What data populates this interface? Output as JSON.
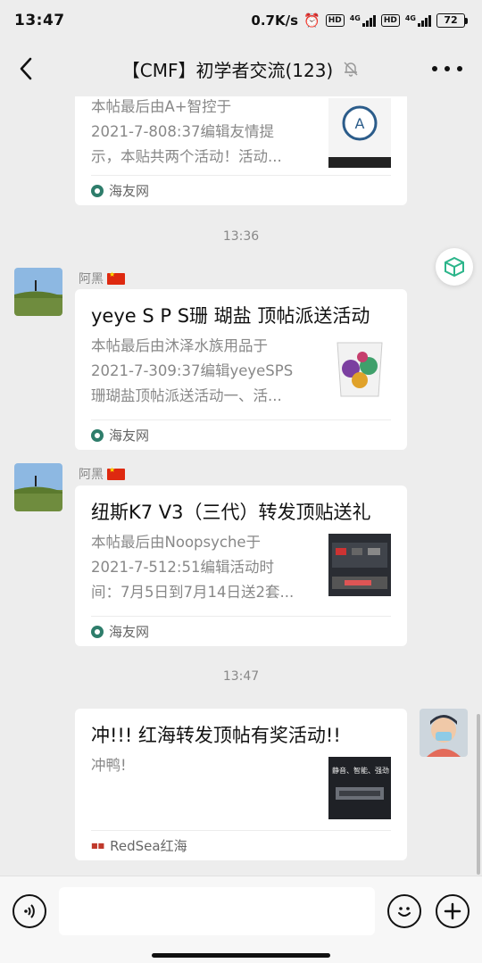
{
  "status": {
    "time": "13:47",
    "speed": "0.7K/s",
    "hd": "HD",
    "net": "4G",
    "battery": "72"
  },
  "header": {
    "title": "【CMF】初学者交流(123)"
  },
  "messages": [
    {
      "title_partial": "本帖最后由A+智控于",
      "desc_lines": [
        "2021-7-808:37编辑友情提",
        "示，本贴共两个活动！活动..."
      ],
      "source": "海友网"
    },
    {
      "timestamp": "13:36",
      "sender": "阿黑",
      "title": "yeye S P S珊 瑚盐 顶帖派送活动",
      "desc_lines": [
        "本帖最后由沐泽水族用品于",
        "2021-7-309:37编辑yeyeSPS",
        "珊瑚盐顶帖派送活动一、活..."
      ],
      "source": "海友网"
    },
    {
      "sender": "阿黑",
      "title": "纽斯K7 V3（三代）转发顶贴送礼",
      "desc_lines": [
        "本帖最后由Noopsyche于",
        "2021-7-512:51编辑活动时",
        "间：7月5日到7月14日送2套..."
      ],
      "source": "海友网"
    },
    {
      "timestamp": "13:47",
      "title": "冲!!! 红海转发顶帖有奖活动!!",
      "desc_lines": [
        "冲鸭!"
      ],
      "source": "RedSea红海",
      "thumb_text": "静音、智能、强劲"
    }
  ],
  "colors": {
    "background": "#ededed",
    "card": "#ffffff",
    "source_icon": "#2e7d6b",
    "floating_icon": "#2bb58a"
  },
  "icons": {
    "back": "chevron-left-icon",
    "mute": "bell-off-icon",
    "more": "more-dots-icon",
    "voice": "voice-icon",
    "emoji": "emoji-icon",
    "plus": "plus-icon"
  }
}
